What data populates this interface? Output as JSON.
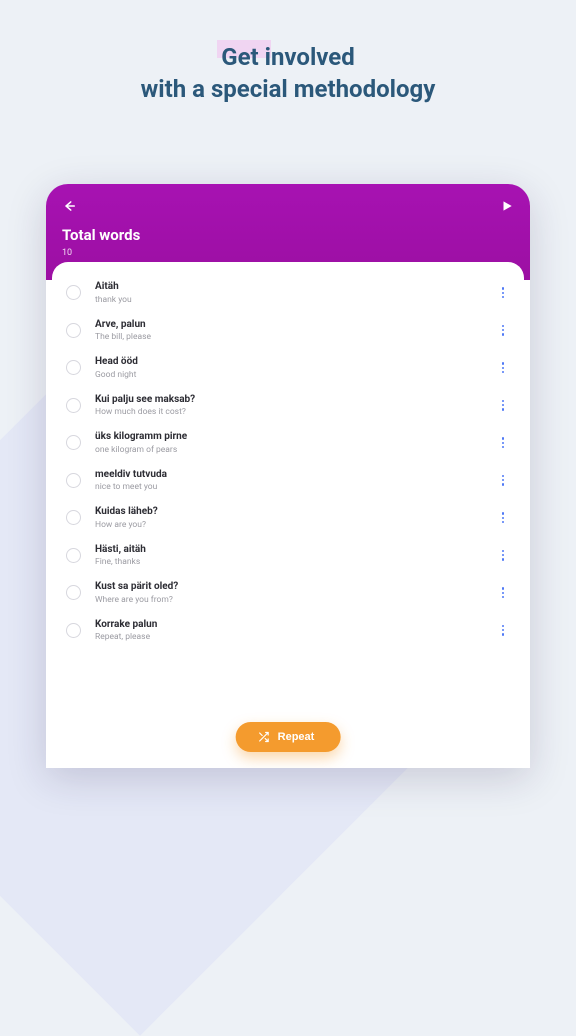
{
  "headline": {
    "line1": "Get involved",
    "line2": "with a special methodology"
  },
  "header": {
    "title": "Total words",
    "count": "10"
  },
  "repeat_label": "Repeat",
  "words": [
    {
      "word": "Aitäh",
      "translation": "thank you"
    },
    {
      "word": "Arve, palun",
      "translation": "The bill, please"
    },
    {
      "word": "Head ööd",
      "translation": "Good night"
    },
    {
      "word": "Kui palju see maksab?",
      "translation": "How much does it cost?"
    },
    {
      "word": "üks kilogramm pirne",
      "translation": "one kilogram of pears"
    },
    {
      "word": "meeldiv tutvuda",
      "translation": "nice to meet you"
    },
    {
      "word": "Kuidas läheb?",
      "translation": "How are you?"
    },
    {
      "word": "Hästi, aitäh",
      "translation": "Fine, thanks"
    },
    {
      "word": "Kust sa pärit oled?",
      "translation": "Where are you from?"
    },
    {
      "word": "Korrake palun",
      "translation": "Repeat, please"
    }
  ]
}
